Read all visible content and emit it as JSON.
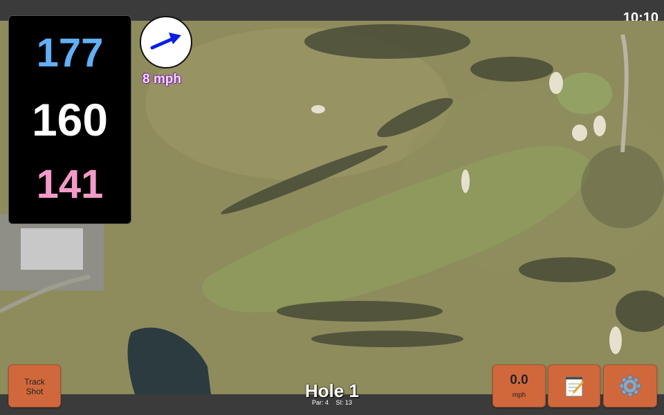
{
  "status_bar": {
    "time": "10:10"
  },
  "distances": {
    "back": "177",
    "middle": "160",
    "front": "141"
  },
  "wind": {
    "speed_label": "8 mph",
    "direction_icon": "arrow-right-up-icon",
    "arrow_color": "#0a1fe6"
  },
  "buttons": {
    "track_shot_line1": "Track",
    "track_shot_line2": "Shot",
    "speed_value": "0.0",
    "speed_unit": "mph",
    "notes_icon": "notepad-icon",
    "settings_icon": "gear-icon"
  },
  "hole": {
    "title": "Hole 1",
    "par": "Par: 4",
    "si": "SI: 13"
  },
  "colors": {
    "button": "#d1683b",
    "back_distance": "#62aff5",
    "front_distance": "#f39ac8",
    "panel": "#000000"
  }
}
